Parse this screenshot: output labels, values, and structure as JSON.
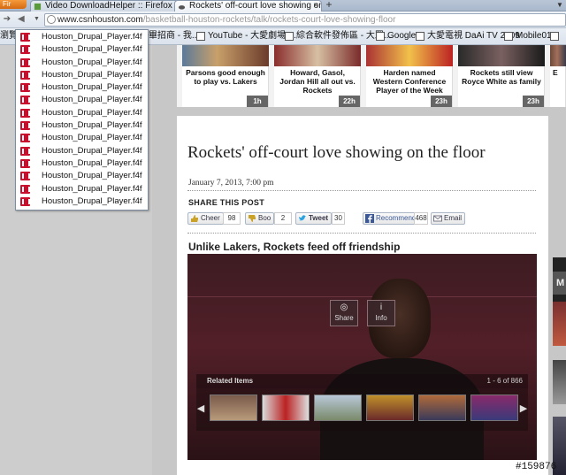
{
  "browser": {
    "app_button": "Fir",
    "tabs": [
      {
        "label": "Video DownloadHelper :: Firefox 附...",
        "active": false
      },
      {
        "label": "Rockets' off-court love showing on...",
        "active": true
      }
    ],
    "new_tab": "+",
    "tab_list": "▼",
    "url_host": "www.csnhouston.com",
    "url_path": "/basketball-houston-rockets/talk/rockets-court-love-showing-floor",
    "bookmarks": [
      "瀏覽",
      "畢招商 - 我...",
      "YouTube - 大愛劇場-...",
      "綜合軟件發佈區 - 大眾...",
      "Google",
      "大愛電視 DaAi TV 2009",
      "Mobile01"
    ]
  },
  "dropdown": {
    "items": [
      "Houston_Drupal_Player.f4f",
      "Houston_Drupal_Player.f4f",
      "Houston_Drupal_Player.f4f",
      "Houston_Drupal_Player.f4f",
      "Houston_Drupal_Player.f4f",
      "Houston_Drupal_Player.f4f",
      "Houston_Drupal_Player.f4f",
      "Houston_Drupal_Player.f4f",
      "Houston_Drupal_Player.f4f",
      "Houston_Drupal_Player.f4f",
      "Houston_Drupal_Player.f4f",
      "Houston_Drupal_Player.f4f",
      "Houston_Drupal_Player.f4f",
      "Houston_Drupal_Player.f4f"
    ]
  },
  "rail": {
    "cards": [
      {
        "title": "Parsons good enough to play vs. Lakers",
        "age": "1h"
      },
      {
        "title": "Howard, Gasol, Jordan Hill all out vs. Rockets",
        "age": "22h"
      },
      {
        "title": "Harden named Western Conference Player of the Week",
        "age": "23h"
      },
      {
        "title": "Rockets still view Royce White as family",
        "age": "23h"
      },
      {
        "title": "E",
        "age": ""
      }
    ]
  },
  "article": {
    "headline": "Rockets' off-court love showing on the floor",
    "date": "January 7, 2013, 7:00 pm",
    "share_title": "SHARE THIS POST",
    "cheer_label": "Cheer",
    "cheer_count": "98",
    "boo_label": "Boo",
    "boo_count": "2",
    "tweet_label": "Tweet",
    "tweet_count": "30",
    "recommend_label": "Recommend",
    "recommend_count": "468",
    "email_label": "Email",
    "subhead": "Unlike Lakers, Rockets feed off friendship"
  },
  "video": {
    "share_label": "Share",
    "info_label": "Info",
    "related_title": "Related Items",
    "related_count": "1 - 6 of 866"
  },
  "right_col": {
    "letter": "M"
  },
  "watermark": "#159876"
}
